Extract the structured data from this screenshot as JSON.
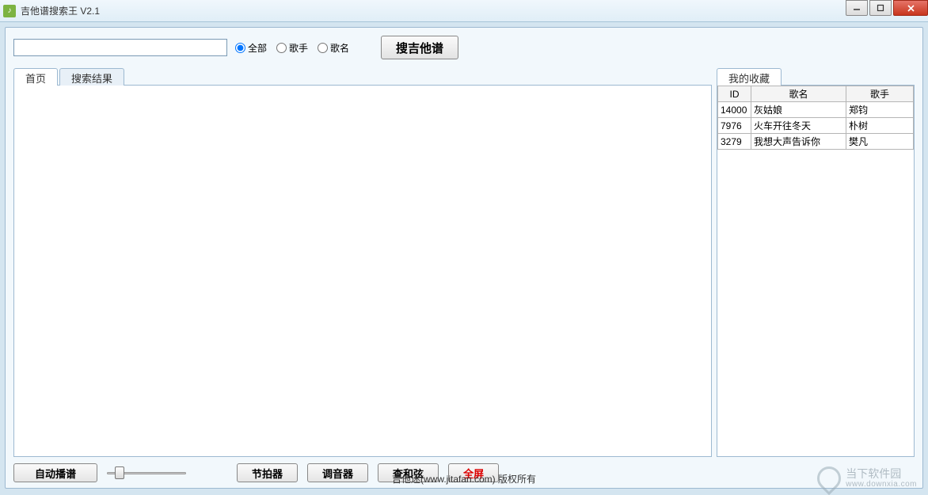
{
  "window": {
    "title": "吉他谱搜索王 V2.1"
  },
  "search": {
    "value": "",
    "placeholder": "",
    "radios": {
      "all": "全部",
      "singer": "歌手",
      "song": "歌名",
      "selected": "all"
    },
    "button": "搜吉他谱"
  },
  "tabs": {
    "home": "首页",
    "results": "搜索结果",
    "active": "home"
  },
  "favorites": {
    "title": "我的收藏",
    "headers": {
      "id": "ID",
      "name": "歌名",
      "singer": "歌手"
    },
    "rows": [
      {
        "id": "14000",
        "name": "灰姑娘",
        "singer": "郑钧"
      },
      {
        "id": "7976",
        "name": "火车开往冬天",
        "singer": "朴树"
      },
      {
        "id": "3279",
        "name": "我想大声告诉你",
        "singer": "樊凡"
      }
    ]
  },
  "toolbar": {
    "autoplay": "自动播谱",
    "metronome": "节拍器",
    "tuner": "调音器",
    "chord": "查和弦",
    "fullscreen": "全屏"
  },
  "footer": "吉他迷(www.jitafan.com) 版权所有",
  "watermark": {
    "cn": "当下软件园",
    "en": "www.downxia.com"
  }
}
